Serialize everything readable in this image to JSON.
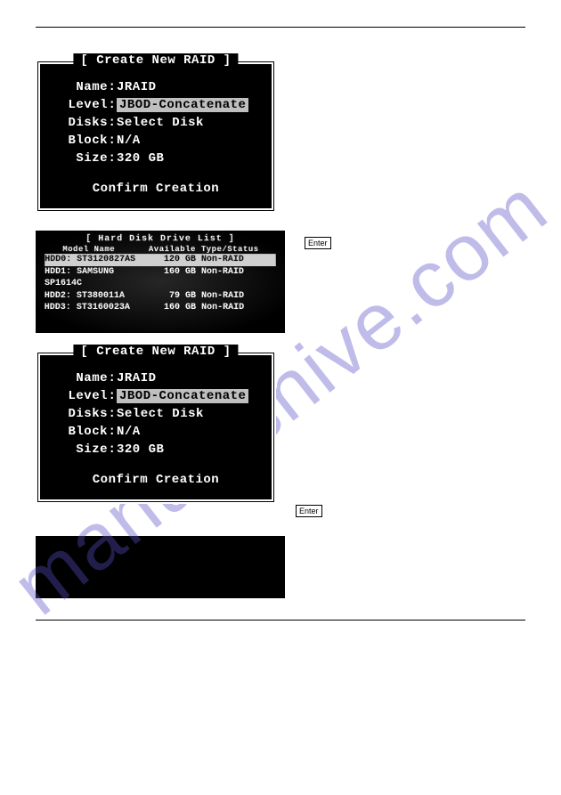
{
  "watermark": "manualshive.com",
  "panel1": {
    "title": "[ Create New RAID ]",
    "fields": {
      "name_k": "Name",
      "name_v": "JRAID",
      "level_k": "Level",
      "level_v": "JBOD-Concatenate",
      "disks_k": "Disks",
      "disks_v": "Select Disk",
      "block_k": "Block",
      "block_v": "N/A",
      "size_k": "Size",
      "size_v": " 320 GB"
    },
    "confirm": "Confirm Creation"
  },
  "hdl": {
    "title": "[ Hard Disk Drive List ]",
    "head": {
      "c1": "Model Name",
      "c2": "Available",
      "c3": "Type/Status"
    },
    "rows": [
      {
        "c1": "HDD0: ST3120827AS",
        "c2": "120 GB",
        "c3": "Non-RAID",
        "selected": true
      },
      {
        "c1": "HDD1: SAMSUNG SP1614C",
        "c2": "160 GB",
        "c3": "Non-RAID",
        "selected": false
      },
      {
        "c1": "HDD2: ST380011A",
        "c2": "79 GB",
        "c3": "Non-RAID",
        "selected": false
      },
      {
        "c1": "HDD3: ST3160023A",
        "c2": "160 GB",
        "c3": "Non-RAID",
        "selected": false
      }
    ]
  },
  "panel2": {
    "title": "[ Create New RAID ]",
    "fields": {
      "name_k": "Name",
      "name_v": "JRAID",
      "level_k": "Level",
      "level_v": "JBOD-Concatenate",
      "disks_k": "Disks",
      "disks_v": "Select Disk",
      "block_k": "Block",
      "block_v": "N/A",
      "size_k": "Size",
      "size_v": " 320 GB"
    },
    "confirm": "Confirm Creation"
  },
  "caption_hdl_key": "Enter",
  "caption_p2_key": "Enter"
}
